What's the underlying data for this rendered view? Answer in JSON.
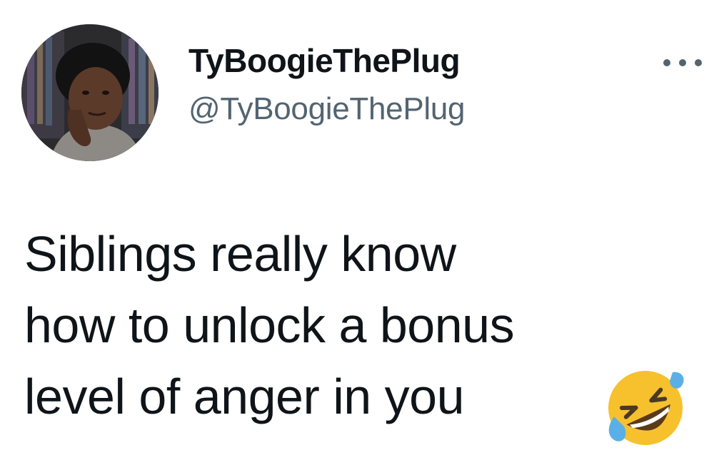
{
  "tweet": {
    "author": {
      "display_name": "TyBoogieThePlug",
      "handle": "@TyBoogieThePlug",
      "avatar_icon": "profile-photo"
    },
    "more_icon": "more-horizontal-icon",
    "text_lines": [
      "Siblings really know",
      "how to unlock a bonus",
      "level of anger in you"
    ],
    "emoji": "rolling-on-the-floor-laughing-emoji"
  },
  "colors": {
    "text_primary": "#0f1419",
    "text_secondary": "#536471",
    "background": "#ffffff",
    "emoji_face": "#f7c12d"
  }
}
